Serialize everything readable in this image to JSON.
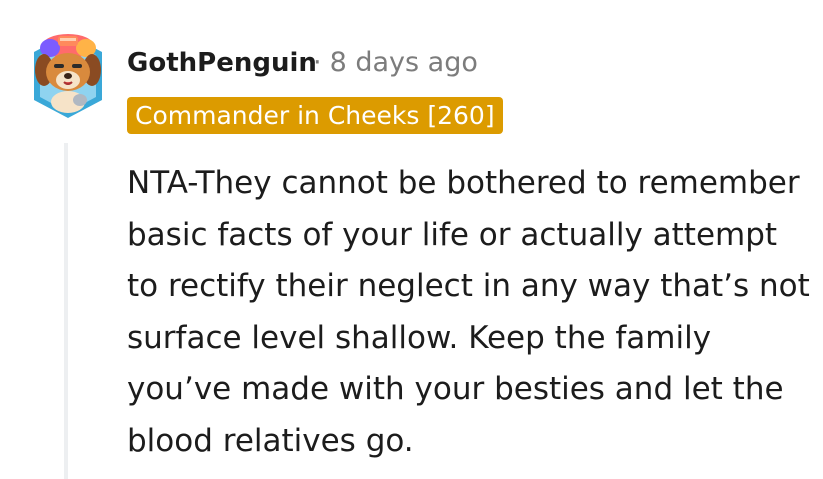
{
  "comment": {
    "username": "GothPenguin",
    "separator": "·",
    "timestamp": "8 days ago",
    "flair": "Commander in Cheeks [260]",
    "body": "NTA-They cannot be bothered to remember basic facts of your life or actually attempt to rectify their neglect in any way that’s not surface level shallow. Keep the family you’ve made with your besties and let the blood relatives go."
  },
  "colors": {
    "flair_background": "#dc9b00",
    "flair_text": "#ffffff",
    "meta_text": "#7c7c7c",
    "thread_line": "#edeff1"
  },
  "avatar": {
    "icon": "dog-avatar-icon"
  }
}
